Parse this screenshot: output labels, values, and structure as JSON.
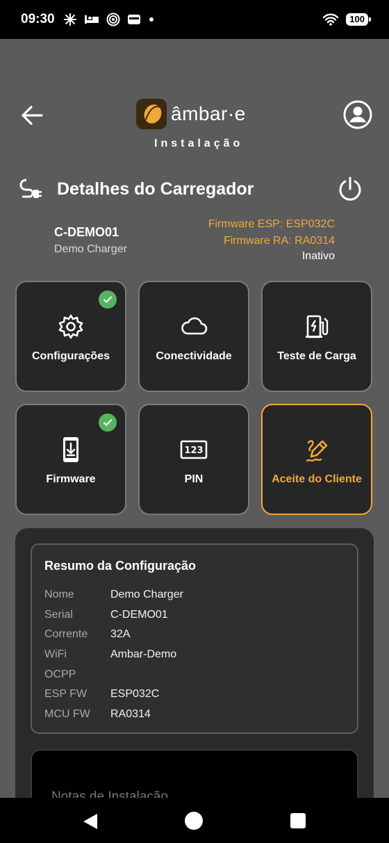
{
  "status_bar": {
    "time": "09:30",
    "battery": "100"
  },
  "header": {
    "brand_name": "âmbar·e",
    "brand_sub": "Instalação"
  },
  "section": {
    "title": "Detalhes do Carregador"
  },
  "charger": {
    "serial": "C-DEMO01",
    "name": "Demo Charger",
    "firmware_esp": "Firmware ESP: ESP032C",
    "firmware_ra": "Firmware RA: RA0314",
    "status": "Inativo"
  },
  "tiles": [
    {
      "label": "Configurações",
      "icon": "gear-icon",
      "done": true
    },
    {
      "label": "Conectividade",
      "icon": "cloud-icon",
      "done": false
    },
    {
      "label": "Teste de Carga",
      "icon": "ev-station-icon",
      "done": false
    },
    {
      "label": "Firmware",
      "icon": "phone-download-icon",
      "done": true
    },
    {
      "label": "PIN",
      "icon": "pin-123-icon",
      "done": false
    },
    {
      "label": "Aceite do Cliente",
      "icon": "signature-icon",
      "done": false,
      "selected": true
    }
  ],
  "summary": {
    "title": "Resumo da Configuração",
    "rows": [
      {
        "key": "Nome",
        "value": "Demo Charger"
      },
      {
        "key": "Serial",
        "value": "C-DEMO01"
      },
      {
        "key": "Corrente",
        "value": "32A"
      },
      {
        "key": "WiFi",
        "value": "Ambar-Demo"
      },
      {
        "key": "OCPP",
        "value": ""
      },
      {
        "key": "ESP FW",
        "value": "ESP032C"
      },
      {
        "key": "MCU FW",
        "value": "RA0314"
      }
    ]
  },
  "notes": {
    "placeholder": "Notas de Instalação"
  },
  "colors": {
    "accent": "#f0a93a",
    "check": "#58b35f",
    "background": "#5b5b5b",
    "card": "#262626"
  }
}
